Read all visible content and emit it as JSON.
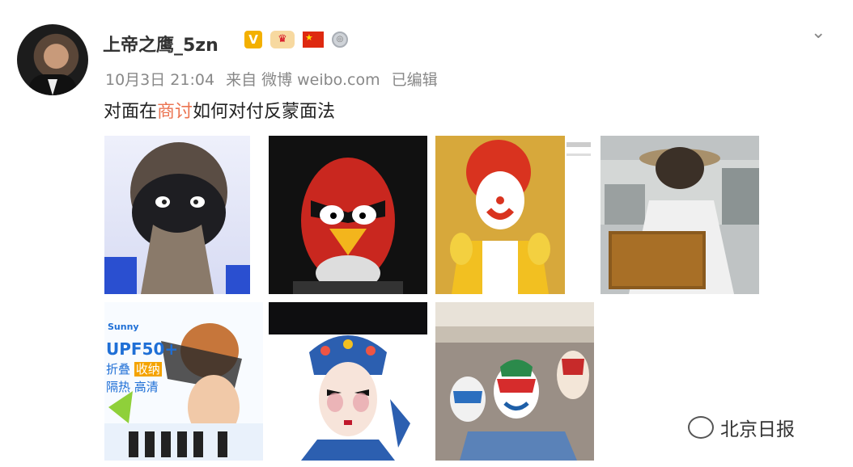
{
  "post": {
    "username": "上帝之鹰_5zn",
    "date": "10月3日 21:04",
    "source_prefix": "来自",
    "source": "微博 weibo.com",
    "edited": "已编辑",
    "text_before": "对面在",
    "text_highlight": "商讨",
    "text_after": "如何对付反蒙面法"
  },
  "badges": {
    "verified": "V",
    "crown": "♛",
    "flag": "★",
    "medal": "◎"
  },
  "menu": {
    "icon": "chevron-down-icon",
    "glyph": "⌄"
  },
  "watermark": {
    "text": "北京日报",
    "icon": "wechat-icon"
  },
  "images": {
    "upf_text": "UPF50+",
    "brand": "Sunny",
    "fold": "折叠",
    "fold_tag": "收纳",
    "uv": "隔热",
    "hd": "高清"
  }
}
